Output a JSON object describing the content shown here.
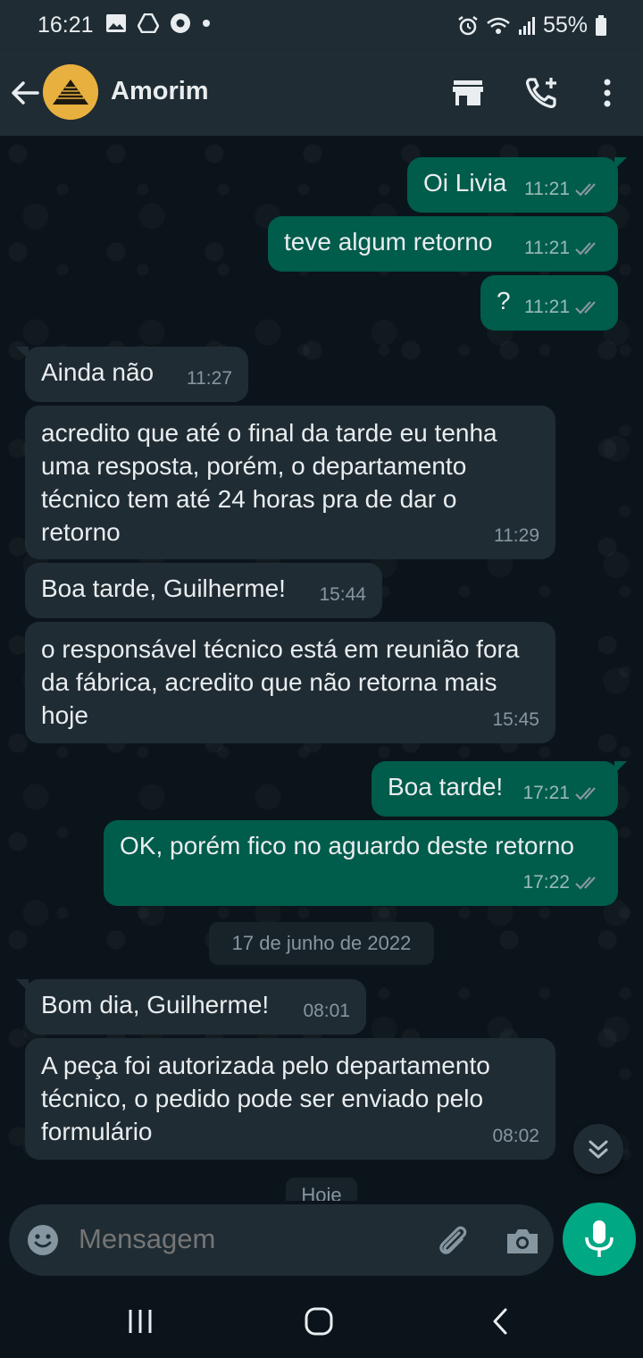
{
  "status_bar": {
    "time": "16:21",
    "battery": "55%",
    "left_icons": [
      "gallery-icon",
      "drive-icon",
      "chrome-icon",
      "dot-icon"
    ],
    "right_icons": [
      "alarm-icon",
      "wifi-icon",
      "signal-icon",
      "battery-icon"
    ]
  },
  "header": {
    "contact_name": "Amorim",
    "icons": [
      "back-arrow-icon",
      "store-icon",
      "add-call-icon",
      "more-vert-icon"
    ]
  },
  "messages": [
    {
      "direction": "out",
      "text": "Oi Livia",
      "time": "11:21",
      "status": "read"
    },
    {
      "direction": "out",
      "text": "teve algum retorno",
      "time": "11:21",
      "status": "read"
    },
    {
      "direction": "out",
      "text": "?",
      "time": "11:21",
      "status": "read"
    },
    {
      "direction": "in",
      "text": "Ainda não",
      "time": "11:27"
    },
    {
      "direction": "in",
      "text": "acredito que até o final da tarde eu tenha uma resposta, porém, o departamento técnico tem até 24 horas pra de dar o retorno",
      "time": "11:29"
    },
    {
      "direction": "in",
      "text": "Boa tarde, Guilherme!",
      "time": "15:44"
    },
    {
      "direction": "in",
      "text": "o responsável técnico está em reunião fora da fábrica, acredito que não retorna mais hoje",
      "time": "15:45"
    },
    {
      "direction": "out",
      "text": "Boa tarde!",
      "time": "17:21",
      "status": "read"
    },
    {
      "direction": "out",
      "text": "OK, porém fico no aguardo deste retorno",
      "time": "17:22",
      "status": "read"
    },
    {
      "direction": "in",
      "text": "Bom dia, Guilherme!",
      "time": "08:01"
    },
    {
      "direction": "in",
      "text": "A peça foi autorizada pelo departamento técnico, o pedido pode ser enviado pelo formulário",
      "time": "08:02"
    }
  ],
  "date_separator": "17 de junho de 2022",
  "next_date_separator": "Hoje",
  "composer": {
    "placeholder": "Mensagem",
    "icons": [
      "emoji-icon",
      "attach-icon",
      "camera-icon",
      "mic-icon"
    ]
  },
  "colors": {
    "background": "#0b141a",
    "header": "#1f2c34",
    "incoming_bubble": "#202c33",
    "outgoing_bubble": "#005c4b",
    "accent": "#00a884"
  }
}
